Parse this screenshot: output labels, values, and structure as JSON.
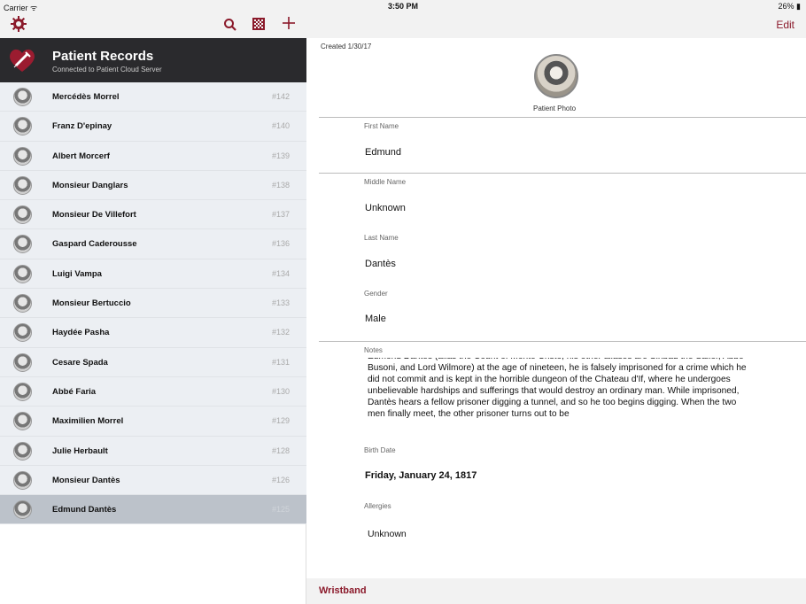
{
  "status": {
    "carrier": "Carrier ᯤ",
    "time": "3:50 PM",
    "battery": "26% ▮"
  },
  "header": {
    "title": "Patient Records",
    "subtitle": "Connected to Patient Cloud Server"
  },
  "patients": [
    {
      "name": "Mercédès Morrel",
      "id": "#142"
    },
    {
      "name": "Franz D'epinay",
      "id": "#140"
    },
    {
      "name": "Albert Morcerf",
      "id": "#139"
    },
    {
      "name": "Monsieur Danglars",
      "id": "#138"
    },
    {
      "name": "Monsieur De Villefort",
      "id": "#137"
    },
    {
      "name": "Gaspard Caderousse",
      "id": "#136"
    },
    {
      "name": "Luigi Vampa",
      "id": "#134"
    },
    {
      "name": "Monsieur  Bertuccio",
      "id": "#133"
    },
    {
      "name": "Haydée Pasha",
      "id": "#132"
    },
    {
      "name": "Cesare Spada",
      "id": "#131"
    },
    {
      "name": "Abbé Faria",
      "id": "#130"
    },
    {
      "name": "Maximilien Morrel",
      "id": "#129"
    },
    {
      "name": "Julie Herbault",
      "id": "#128"
    },
    {
      "name": "Monsieur Dantès",
      "id": "#126"
    },
    {
      "name": "Edmund Dantès",
      "id": "#125",
      "selected": true
    }
  ],
  "detail": {
    "edit_label": "Edit",
    "created": "Created 1/30/17",
    "photo_label": "Patient Photo",
    "first_name_label": "First Name",
    "first_name": "Edmund",
    "middle_name_label": "Middle Name",
    "middle_name": "Unknown",
    "last_name_label": "Last Name",
    "last_name": "Dantès",
    "gender_label": "Gender",
    "gender": "Male",
    "notes_label": "Notes",
    "notes": "Edmond Dantès (alias the Count of Monte Cristo, his other aliases are Sinbad the Sailor, Abbé Busoni, and Lord Wilmore) at the age of nineteen, he is falsely imprisoned for a crime which he did not commit and is kept in the horrible dungeon of the Chateau d'If, where he undergoes unbelievable hardships and sufferings that would destroy an ordinary man. While imprisoned, Dantès hears a fellow prisoner digging a tunnel, and so he too begins digging. When the two men finally meet, the other prisoner turns out to be",
    "birth_date_label": "Birth Date",
    "birth_date": "Friday, January 24, 1817",
    "allergies_label": "Allergies",
    "allergies": "Unknown",
    "wristband_label": "Wristband"
  },
  "colors": {
    "accent": "#8b1a2b",
    "header_bg": "#2a2a2d",
    "list_bg": "#eceff3",
    "selected_bg": "#bcc2ca"
  }
}
